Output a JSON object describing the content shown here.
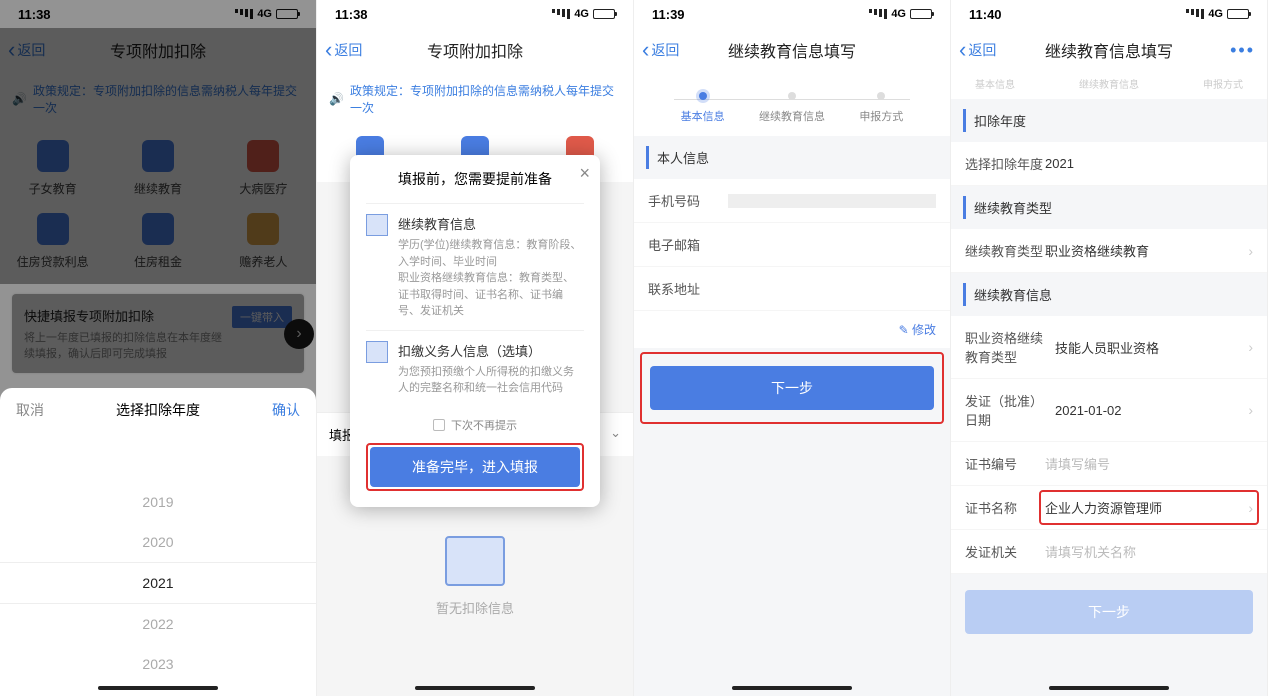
{
  "status_time": [
    "11:38",
    "11:38",
    "11:39",
    "11:40"
  ],
  "signal_label": "4G",
  "back_label": "返回",
  "screen1": {
    "title": "专项附加扣除",
    "notice": "政策规定：专项附加扣除的信息需纳税人每年提交一次",
    "menu": [
      "子女教育",
      "继续教育",
      "大病医疗",
      "住房贷款利息",
      "住房租金",
      "赡养老人"
    ],
    "quick_title": "快捷填报专项附加扣除",
    "quick_desc": "将上一年度已填报的扣除信息在本年度继续填报，确认后即可完成填报",
    "quick_btn": "一键带入",
    "sheet_title": "选择扣除年度",
    "cancel": "取消",
    "confirm": "确认",
    "years": [
      "2019",
      "2020",
      "2021",
      "2022",
      "2023"
    ],
    "selected_year": "2021"
  },
  "screen2": {
    "title": "专项附加扣除",
    "notice": "政策规定：专项附加扣除的信息需纳税人每年提交一次",
    "modal_title": "填报前，您需要提前准备",
    "sec1_title": "继续教育信息",
    "sec1_desc": "学历(学位)继续教育信息：教育阶段、入学时间、毕业时间\n职业资格继续教育信息：教育类型、证书取得时间、证书名称、证书编号、发证机关",
    "sec2_title": "扣缴义务人信息（选填）",
    "sec2_desc": "为您预扣预缴个人所得税的扣缴义务人的完整名称和统一社会信用代码",
    "dont_show": "下次不再提示",
    "primary_btn": "准备完毕，进入填报",
    "fill_label": "填报",
    "empty": "暂无扣除信息"
  },
  "screen3": {
    "title": "继续教育信息填写",
    "steps": [
      "基本信息",
      "继续教育信息",
      "申报方式"
    ],
    "section_personal": "本人信息",
    "phone_label": "手机号码",
    "email_label": "电子邮箱",
    "address_label": "联系地址",
    "edit": "修改",
    "next_btn": "下一步"
  },
  "screen4": {
    "title": "继续教育信息填写",
    "more": "•••",
    "steps_partial": [
      "基本信息",
      "继续教育信息",
      "申报方式"
    ],
    "sec_year": "扣除年度",
    "year_label": "选择扣除年度",
    "year_value": "2021",
    "sec_type": "继续教育类型",
    "edu_type_label": "继续教育类型",
    "edu_type_value": "职业资格继续教育",
    "sec_info": "继续教育信息",
    "qual_type_label": "职业资格继续教育类型",
    "qual_type_value": "技能人员职业资格",
    "date_label": "发证（批准）日期",
    "date_value": "2021-01-02",
    "cert_no_label": "证书编号",
    "cert_no_ph": "请填写编号",
    "cert_name_label": "证书名称",
    "cert_name_value": "企业人力资源管理师",
    "issuer_label": "发证机关",
    "issuer_ph": "请填写机关名称",
    "next_btn": "下一步"
  }
}
